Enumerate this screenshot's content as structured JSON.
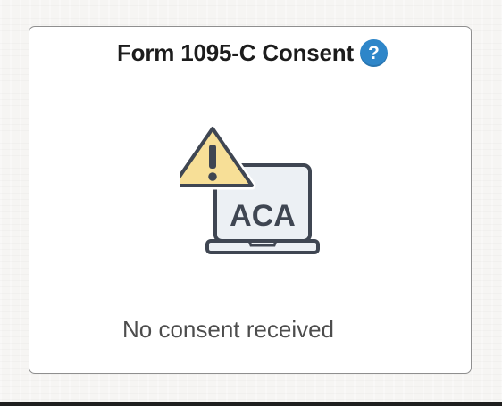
{
  "card": {
    "title": "Form 1095-C Consent",
    "help_icon": "question-mark-icon",
    "help_glyph": "?",
    "illustration": {
      "laptop_label": "ACA",
      "icons": [
        "warning-triangle-icon",
        "laptop-icon"
      ]
    },
    "status_text": "No consent received"
  },
  "colors": {
    "help_icon_bg": "#2e86c9",
    "warning_fill": "#f7df97",
    "laptop_screen": "#ecf0f4",
    "outline": "#3f4652",
    "title_text": "#1c1c1c",
    "status_text": "#4d4d4d"
  }
}
